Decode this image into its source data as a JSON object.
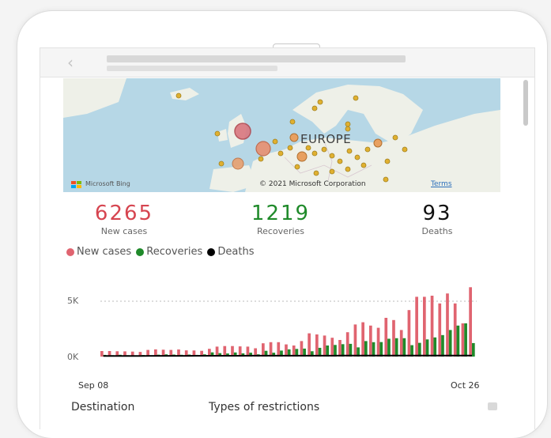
{
  "map": {
    "region_label": "EUROPE",
    "bing_label": "Microsoft Bing",
    "copyright": "© 2021 Microsoft Corporation",
    "terms_link": "Terms"
  },
  "kpis": [
    {
      "value": "6265",
      "label": "New cases",
      "color": "#d64550"
    },
    {
      "value": "1219",
      "label": "Recoveries",
      "color": "#1f8a2a"
    },
    {
      "value": "93",
      "label": "Deaths",
      "color": "#111111"
    }
  ],
  "legend": [
    {
      "label": "New cases",
      "color": "#e06470"
    },
    {
      "label": "Recoveries",
      "color": "#1f8a2a"
    },
    {
      "label": "Deaths",
      "color": "#000000"
    }
  ],
  "table": {
    "columns": [
      "Destination",
      "Types of restrictions"
    ]
  },
  "chart_data": {
    "type": "bar",
    "x_start_label": "Sep 08",
    "x_end_label": "Oct 26",
    "ytick_labels": [
      "5K",
      "0K"
    ],
    "ylim": [
      0,
      6500
    ],
    "series": [
      {
        "name": "New cases",
        "color": "#e06470",
        "values": [
          500,
          500,
          480,
          470,
          450,
          420,
          600,
          650,
          620,
          600,
          640,
          560,
          550,
          520,
          700,
          900,
          950,
          950,
          920,
          900,
          750,
          1200,
          1300,
          1300,
          1100,
          1000,
          1400,
          2100,
          2000,
          1900,
          1700,
          1500,
          2200,
          2900,
          3100,
          2800,
          2600,
          3500,
          3300,
          2400,
          4200,
          5400,
          5400,
          5500,
          4800,
          5700,
          4800,
          3000,
          6265
        ]
      },
      {
        "name": "Recoveries",
        "color": "#1f8a2a",
        "values": [
          150,
          120,
          160,
          120,
          110,
          140,
          100,
          170,
          200,
          180,
          160,
          180,
          150,
          200,
          380,
          310,
          280,
          370,
          290,
          350,
          200,
          520,
          350,
          540,
          650,
          690,
          720,
          480,
          790,
          1000,
          1050,
          1120,
          1150,
          830,
          1400,
          1300,
          1310,
          1610,
          1660,
          1660,
          1030,
          1240,
          1550,
          1730,
          1940,
          2400,
          2800,
          3000,
          1219
        ]
      },
      {
        "name": "Deaths",
        "color": "#000000",
        "values": [
          50,
          52,
          54,
          55,
          56,
          58,
          60,
          62,
          63,
          64,
          65,
          66,
          67,
          68,
          70,
          72,
          72,
          74,
          75,
          76,
          77,
          78,
          79,
          80,
          80,
          81,
          82,
          82,
          83,
          84,
          84,
          85,
          86,
          86,
          87,
          88,
          88,
          89,
          89,
          90,
          90,
          91,
          91,
          92,
          92,
          92,
          93,
          93,
          93
        ]
      }
    ]
  }
}
